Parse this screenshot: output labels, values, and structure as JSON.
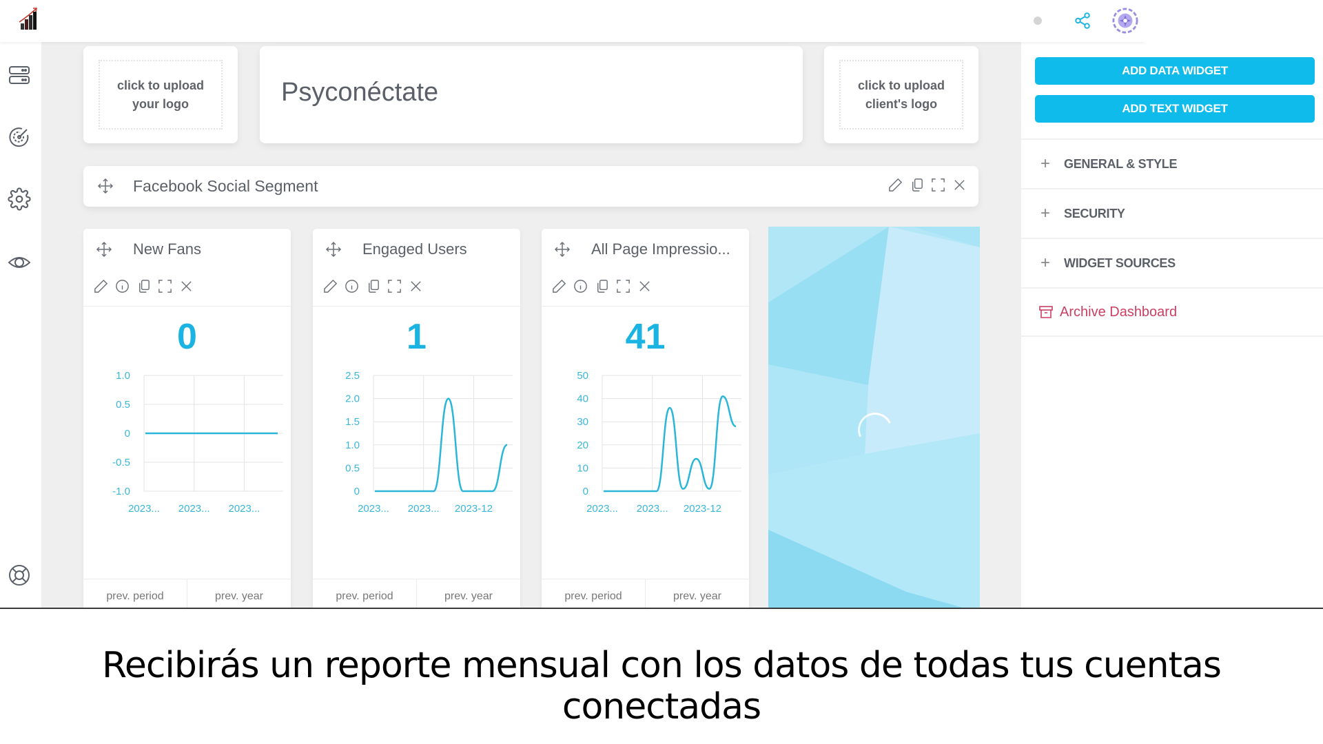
{
  "topbar": {
    "logo": "growth-chart-logo",
    "status_dot_color": "#d4d4d4",
    "share_icon": "share-icon",
    "avatar_icon": "avatar-icon"
  },
  "rail": {
    "items": [
      {
        "icon": "server-icon",
        "label": "Data sources"
      },
      {
        "icon": "target-icon",
        "label": "Goals"
      },
      {
        "icon": "gear-icon",
        "label": "Settings"
      },
      {
        "icon": "eye-icon",
        "label": "Preview"
      },
      {
        "icon": "lifebuoy-icon",
        "label": "Help"
      }
    ]
  },
  "header": {
    "upload_logo": "click to upload your logo",
    "title": "Psyconéctate",
    "upload_client_logo": "click to upload client's logo"
  },
  "segment": {
    "title": "Facebook Social Segment"
  },
  "widgets": [
    {
      "title": "New Fans",
      "value": "0",
      "prev_period": "prev. period",
      "prev_year": "prev. year"
    },
    {
      "title": "Engaged Users",
      "value": "1",
      "prev_period": "prev. period",
      "prev_year": "prev. year"
    },
    {
      "title": "All Page Impressio...",
      "value": "41",
      "prev_period": "prev. period",
      "prev_year": "prev. year"
    }
  ],
  "panel": {
    "add_data_widget": "ADD DATA WIDGET",
    "add_text_widget": "ADD TEXT WIDGET",
    "sections": [
      "GENERAL & STYLE",
      "SECURITY",
      "WIDGET SOURCES"
    ],
    "archive": "Archive Dashboard",
    "accent_color": "#0fbbeb",
    "archive_color": "#c93f62"
  },
  "caption": "Recibirás un reporte mensual con los datos de todas tus cuentas conectadas",
  "chart_data": [
    {
      "type": "line",
      "title": "New Fans",
      "x_ticks": [
        "2023...",
        "2023...",
        "2023..."
      ],
      "y_ticks": [
        "1.0",
        "0.5",
        "0",
        "-0.5",
        "-1.0"
      ],
      "ylim": [
        -1,
        1
      ],
      "values": [
        0,
        0,
        0,
        0,
        0,
        0,
        0,
        0,
        0,
        0
      ],
      "grid": true,
      "color": "#29b6d8"
    },
    {
      "type": "line",
      "title": "Engaged Users",
      "x_ticks": [
        "2023...",
        "2023...",
        "2023-12"
      ],
      "y_ticks": [
        "2.5",
        "2.0",
        "1.5",
        "1.0",
        "0.5",
        "0"
      ],
      "ylim": [
        0,
        2.5
      ],
      "values": [
        0,
        0,
        0,
        0,
        0,
        2,
        0,
        0,
        0,
        1
      ],
      "grid": true,
      "color": "#29b6d8"
    },
    {
      "type": "line",
      "title": "All Page Impressions",
      "x_ticks": [
        "2023...",
        "2023...",
        "2023-12"
      ],
      "y_ticks": [
        "50",
        "40",
        "30",
        "20",
        "10",
        "0"
      ],
      "ylim": [
        0,
        50
      ],
      "values": [
        0,
        0,
        0,
        0,
        0,
        36,
        1,
        14,
        1,
        41,
        28
      ],
      "grid": true,
      "color": "#29b6d8"
    }
  ]
}
